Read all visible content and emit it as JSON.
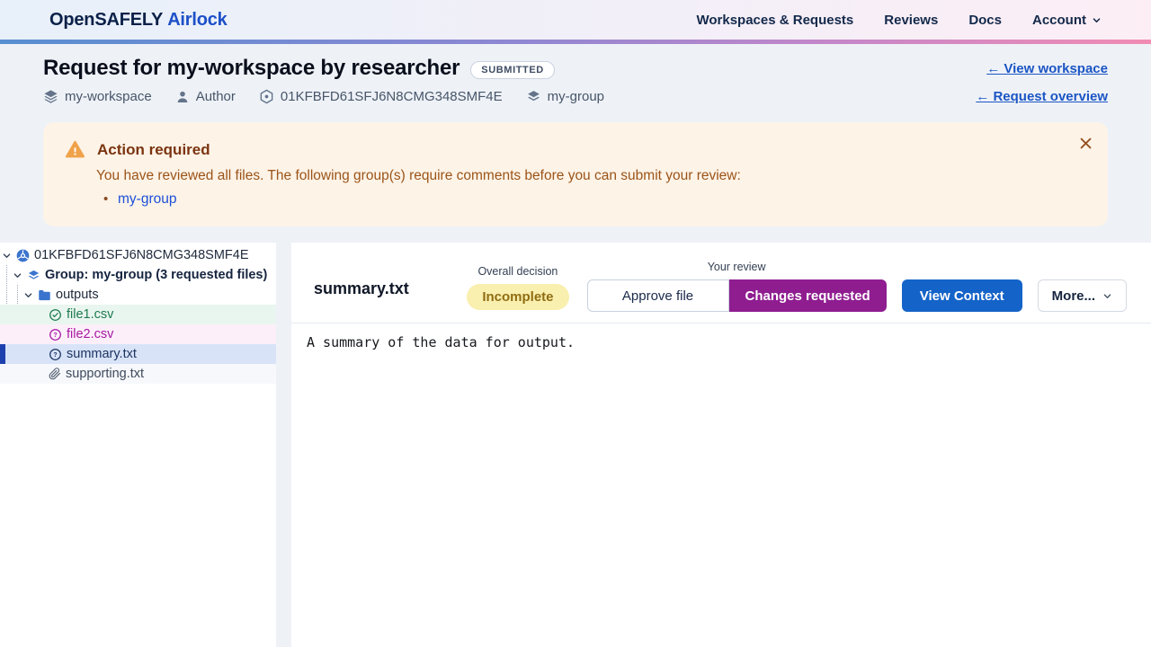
{
  "navbar": {
    "brand_primary": "OpenSAFELY",
    "brand_secondary": "Airlock",
    "links": [
      "Workspaces & Requests",
      "Reviews",
      "Docs"
    ],
    "account_label": "Account"
  },
  "header": {
    "title": "Request for my-workspace by researcher",
    "status_badge": "SUBMITTED",
    "view_workspace_link": "← View workspace",
    "request_overview_link": "← Request overview",
    "meta": [
      {
        "icon": "layers-icon",
        "label": "my-workspace"
      },
      {
        "icon": "user-icon",
        "label": "Author"
      },
      {
        "icon": "request-id-icon",
        "label": "01KFBFD61SFJ6N8CMG348SMF4E"
      },
      {
        "icon": "group-icon",
        "label": "my-group"
      }
    ]
  },
  "alert": {
    "title": "Action required",
    "message": "You have reviewed all files. The following group(s) require comments before you can submit your review:",
    "groups": [
      "my-group"
    ]
  },
  "tree": {
    "root_label": "01KFBFD61SFJ6N8CMG348SMF4E",
    "group_label": "Group: my-group (3 requested files)",
    "folder_label": "outputs",
    "files": [
      {
        "name": "file1.csv",
        "state": "approved"
      },
      {
        "name": "file2.csv",
        "state": "changes_requested"
      },
      {
        "name": "summary.txt",
        "state": "changes_requested",
        "selected": true
      },
      {
        "name": "supporting.txt",
        "state": "supporting"
      }
    ]
  },
  "file_view": {
    "filename": "summary.txt",
    "overall_decision_label": "Overall decision",
    "overall_decision_value": "Incomplete",
    "your_review_label": "Your review",
    "approve_button": "Approve file",
    "changes_button": "Changes requested",
    "context_button": "View Context",
    "more_button": "More...",
    "content": "A summary of the data for output."
  },
  "colors": {
    "accent_blue": "#1463c8",
    "accent_purple": "#8f1d90",
    "link_blue": "#1b55c4",
    "warning_bg": "#fdf3e7",
    "warning_text": "#9b5418",
    "incomplete_bg": "#f9efae",
    "approved_green": "#1d7a4e",
    "changes_magenta": "#a718a3",
    "selected_navy": "#1e40af"
  }
}
